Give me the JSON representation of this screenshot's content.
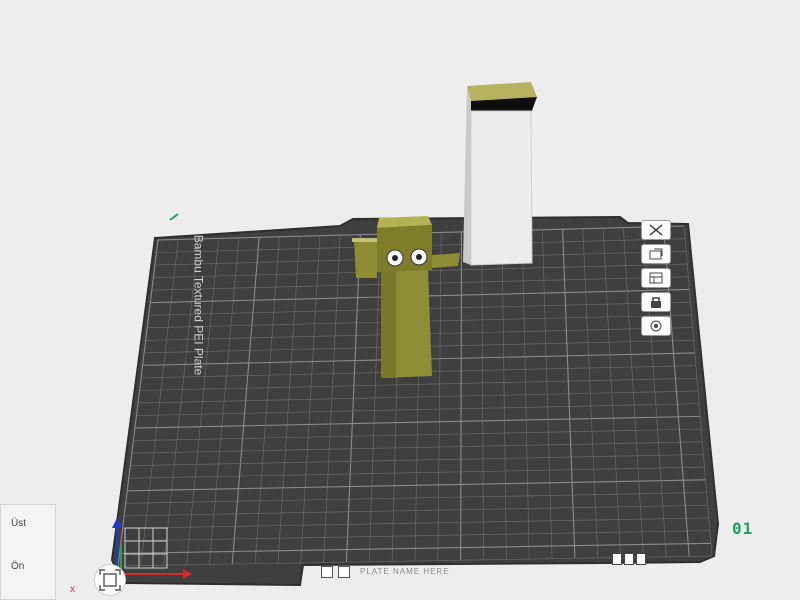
{
  "plate": {
    "name": "Bambu Textured PEI Plate",
    "number": "01",
    "bottom_bar_text": "PLATE NAME HERE"
  },
  "view_cube": {
    "top_label": "Üst",
    "front_label": "Ön"
  },
  "axes": {
    "x_label": "x"
  },
  "plate_tools": [
    {
      "name": "arrange-icon"
    },
    {
      "name": "orient-icon"
    },
    {
      "name": "plate-settings-icon"
    },
    {
      "name": "lock-icon"
    },
    {
      "name": "slice-icon"
    }
  ],
  "colors": {
    "accent": "#1aa65a",
    "plate": "#4a4a4a",
    "model_olive": "#8c8a2f",
    "tower_white": "#d8d8d8"
  }
}
